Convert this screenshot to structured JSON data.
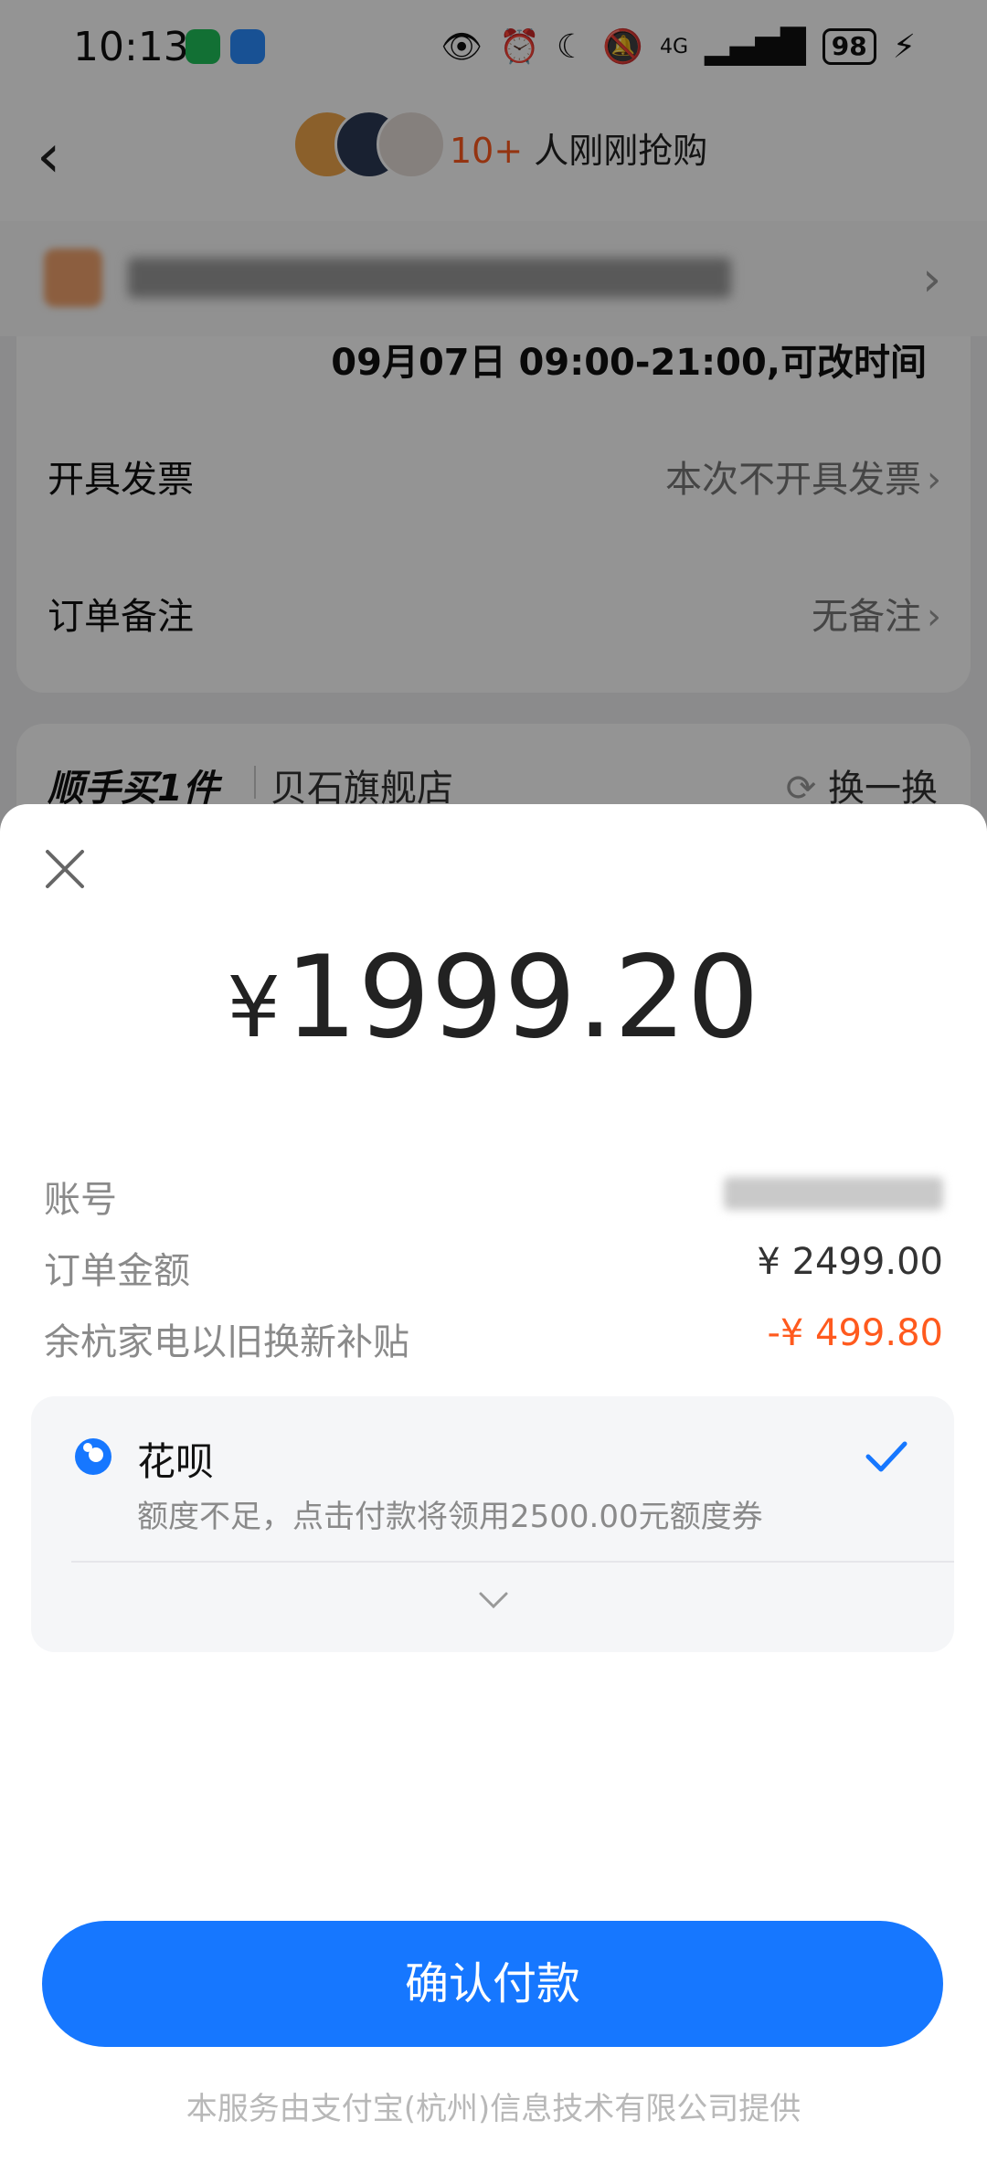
{
  "status_bar": {
    "time": "10:13",
    "network": "4G",
    "battery": "98"
  },
  "nav": {
    "back_icon": "chevron-left-icon",
    "buyers_count": "10+",
    "buyers_text": "人刚刚抢购"
  },
  "order": {
    "delivery_time": "09月07日 09:00-21:00,可改时间",
    "invoice_label": "开具发票",
    "invoice_value": "本次不开具发票",
    "note_label": "订单备注",
    "note_value": "无备注",
    "addon_title": "顺手买1件",
    "addon_store": "贝石旗舰店",
    "addon_swap": "换一换"
  },
  "payment": {
    "currency_symbol": "¥",
    "amount": "1999.20",
    "account_label": "账号",
    "order_amount_label": "订单金额",
    "order_amount_value": "¥ 2499.00",
    "subsidy_label": "余杭家电以旧换新补贴",
    "subsidy_value": "-¥ 499.80",
    "method_name": "花呗",
    "method_desc": "额度不足，点击付款将领用2500.00元额度券",
    "confirm_label": "确认付款",
    "footer": "本服务由支付宝(杭州)信息技术有限公司提供",
    "colors": {
      "primary": "#1677ff",
      "discount": "#ff5a1e"
    }
  }
}
